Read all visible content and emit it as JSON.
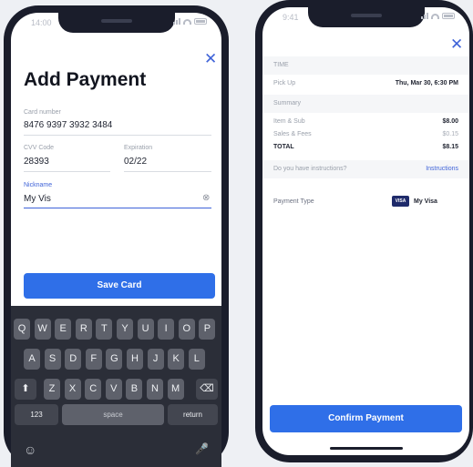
{
  "add_payment": {
    "status": {
      "time": "14:00"
    },
    "title": "Add Payment",
    "card_number": {
      "label": "Card number",
      "value": "8476 9397 3932 3484"
    },
    "cvc": {
      "label": "CVV Code",
      "value": "28393"
    },
    "expiration": {
      "label": "Expiration",
      "value": "02/22"
    },
    "nickname": {
      "label": "Nickname",
      "value": "My Vis",
      "clear_glyph": "⊗"
    },
    "save_button": "Save Card",
    "keyboard": {
      "row1": [
        "Q",
        "W",
        "E",
        "R",
        "T",
        "Y",
        "U",
        "I",
        "O",
        "P"
      ],
      "row2": [
        "A",
        "S",
        "D",
        "F",
        "G",
        "H",
        "J",
        "K",
        "L"
      ],
      "row3": [
        "Z",
        "X",
        "C",
        "V",
        "B",
        "N",
        "M"
      ],
      "shift_glyph": "⬆",
      "delete_glyph": "⌫",
      "numbers_label": "123",
      "space_label": "space",
      "return_label": "return",
      "emoji_glyph": "☺",
      "mic_glyph": "🎤"
    }
  },
  "confirm_payment": {
    "status": {
      "time": "9:41"
    },
    "section_time_label": "TIME",
    "pickup_label": "Pick Up",
    "pickup_value": "Thu, Mar 30, 6:30 PM",
    "summary_label": "Summary",
    "subtotal_label": "Item & Sub",
    "subtotal_value": "$8.00",
    "fees_label": "Sales & Fees",
    "fees_value": "$0.15",
    "total_label": "TOTAL",
    "total_value": "$8.15",
    "instructions_label": "Do you have instructions?",
    "instructions_link": "Instructions",
    "payment_type_label": "Payment Type",
    "card_brand": "VISA",
    "card_name": "My Visa",
    "confirm_button": "Confirm Payment"
  }
}
